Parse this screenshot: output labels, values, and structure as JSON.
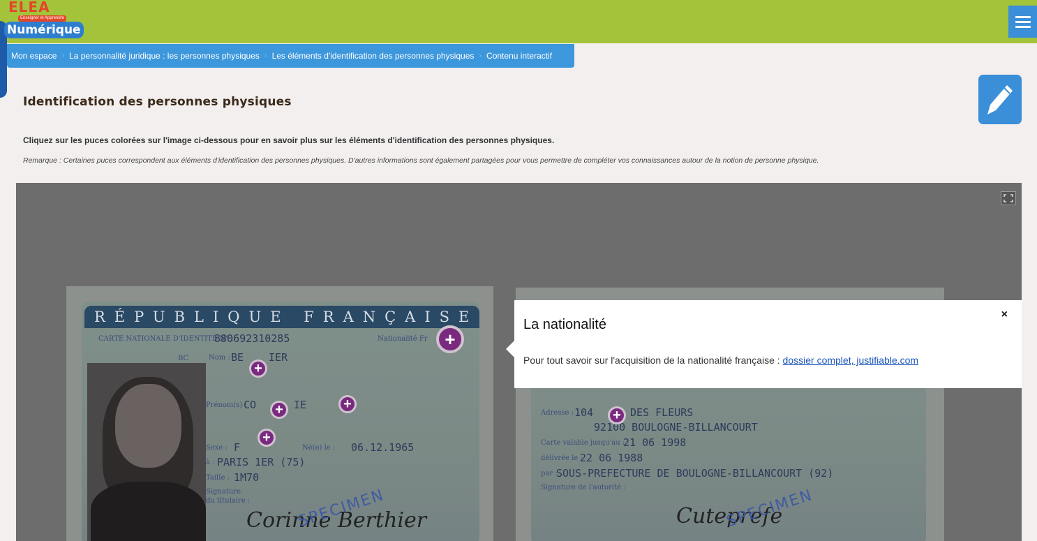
{
  "header": {
    "logo_top": "ELEA",
    "logo_tagline": "Enseigner et Apprendre",
    "logo_bottom": "Numérique",
    "menu_icon": "hamburger-menu-icon"
  },
  "breadcrumb": {
    "items": [
      "Mon espace",
      "La personnalité juridique : les personnes physiques",
      "Les éléments d'identification des personnes physiques",
      "Contenu interactif"
    ]
  },
  "page": {
    "title": "Identification des personnes physiques",
    "edit_icon": "pencil-icon",
    "intro": "Cliquez sur les puces colorées sur l'image ci-dessous pour en savoir plus sur les éléments d'identification des personnes physiques.",
    "remark": "Remarque : Certaines puces correspondent aux éléments d'identification des personnes physiques. D'autres informations sont également partagées pour vous permettre de compléter vos connaissances autour de la notion de personne physique."
  },
  "viewer": {
    "fullscreen_icon": "fullscreen-icon",
    "card_front": {
      "band": "RÉPUBLIQUE FRANÇAISE",
      "carte_label": "CARTE NATIONALE D'IDENTITÉ N° :",
      "carte_number": "880692310285",
      "nationalite_label": "Nationalité Fr",
      "bc": "BC",
      "nom_label": "Nom :",
      "nom_value": "BE",
      "nom_value2": "IER",
      "prenom_label": "Prénom(s) :",
      "prenom_value": "CO",
      "prenom_value2": "IE",
      "sexe_label": "Sexe :",
      "sexe_value": "F",
      "nele_label": "Né(e) le :",
      "nele_value": "06.12.1965",
      "a_label": "à :",
      "a_value": "PARIS 1ER (75)",
      "taille_label": "Taille :",
      "taille_value": "1M70",
      "signature_label": "Signature",
      "titulaire_label": "du titulaire :",
      "signature_text": "Corinne Berthier",
      "specimen": "SPECIMEN"
    },
    "card_back": {
      "adresse_label": "Adresse :",
      "adresse_value": "104",
      "adresse_value2": "DES FLEURS",
      "adresse_line2": "92100 BOULOGNE-BILLANCOURT",
      "valable_label": "Carte valable jusqu'au :",
      "valable_value": "21 06 1998",
      "delivree_label": "délivrée le :",
      "delivree_value": "22 06 1988",
      "par_label": "par :",
      "par_value": "SOUS-PREFECTURE DE BOULOGNE-BILLANCOURT (92)",
      "signature_label": "Signature de l'autorité :",
      "signature_text": "Cuteprefe",
      "specimen": "SPECIMEN"
    },
    "popup": {
      "title": "La nationalité",
      "text": "Pour tout savoir sur l'acquisition de la nationalité française :",
      "link": "dossier complet, justifiable.com",
      "close": "×"
    },
    "hotspot_symbol": "+"
  },
  "colors": {
    "topbar": "#a3c43a",
    "breadcrumb": "#3d97dc",
    "hotspot": "#7a2a7e",
    "link": "#1a55b9"
  }
}
